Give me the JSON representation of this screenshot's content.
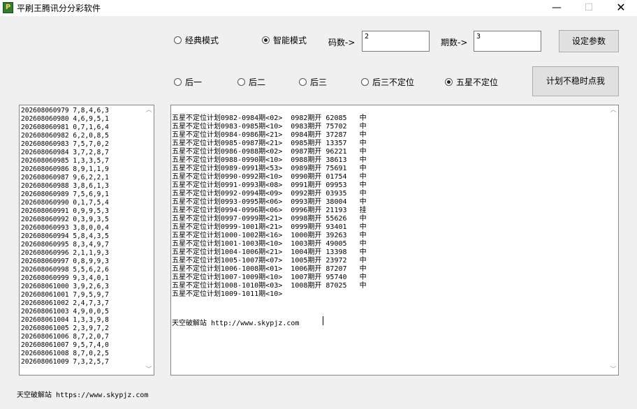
{
  "window": {
    "title": "平刷王腾讯分分彩软件",
    "app_icon": "app-logo-icon",
    "minimize_glyph": "—",
    "maximize_glyph": "☐",
    "close_glyph": "✕"
  },
  "modes": [
    {
      "label": "经典模式",
      "selected": false
    },
    {
      "label": "智能模式",
      "selected": true
    }
  ],
  "code_count": {
    "label": "码数->",
    "value": "2"
  },
  "period_count": {
    "label": "期数->",
    "value": "3"
  },
  "buttons": {
    "set_params": "设定参数",
    "unstable_plan": "计划不稳时点我"
  },
  "positions": [
    {
      "label": "后一",
      "selected": false
    },
    {
      "label": "后二",
      "selected": false
    },
    {
      "label": "后三",
      "selected": false
    },
    {
      "label": "后三不定位",
      "selected": false
    },
    {
      "label": "五星不定位",
      "selected": true
    }
  ],
  "history": [
    "202608060979 7,8,4,6,3",
    "202608060980 4,6,9,5,1",
    "202608060981 0,7,1,6,4",
    "202608060982 6,2,0,8,5",
    "202608060983 7,5,7,0,2",
    "202608060984 3,7,2,8,7",
    "202608060985 1,3,3,5,7",
    "202608060986 8,9,1,1,9",
    "202608060987 9,6,2,2,1",
    "202608060988 3,8,6,1,3",
    "202608060989 7,5,6,9,1",
    "202608060990 0,1,7,5,4",
    "202608060991 0,9,9,5,3",
    "202608060992 0,3,9,3,5",
    "202608060993 3,8,0,0,4",
    "202608060994 5,8,4,3,5",
    "202608060995 8,3,4,9,7",
    "202608060996 2,1,1,9,3",
    "202608060997 0,8,9,9,3",
    "202608060998 5,5,6,2,6",
    "202608060999 9,3,4,0,1",
    "202608061000 3,9,2,6,3",
    "202608061001 7,9,5,9,7",
    "202608061002 2,4,7,3,7",
    "202608061003 4,9,0,0,5",
    "202608061004 1,3,3,9,8",
    "202608061005 2,3,9,7,2",
    "202608061006 8,7,2,0,7",
    "202608061007 9,5,7,4,0",
    "202608061008 8,7,0,2,5",
    "202608061009 7,3,2,5,7"
  ],
  "plan_lines": [
    "五星不定位计划0982-0984期<02>  0982期开 62085   中",
    "五星不定位计划0983-0985期<10>  0983期开 75702   中",
    "五星不定位计划0984-0986期<21>  0984期开 37287   中",
    "五星不定位计划0985-0987期<21>  0985期开 13357   中",
    "五星不定位计划0986-0988期<02>  0987期开 96221   中",
    "五星不定位计划0988-0990期<10>  0988期开 38613   中",
    "五星不定位计划0989-0991期<53>  0989期开 75691   中",
    "五星不定位计划0990-0992期<10>  0990期开 01754   中",
    "五星不定位计划0991-0993期<08>  0991期开 09953   中",
    "五星不定位计划0992-0994期<09>  0992期开 03935   中",
    "五星不定位计划0993-0995期<06>  0993期开 38004   中",
    "五星不定位计划0994-0996期<06>  0996期开 21193   挂",
    "五星不定位计划0997-0999期<21>  0998期开 55626   中",
    "五星不定位计划0999-1001期<21>  0999期开 93401   中",
    "五星不定位计划1000-1002期<16>  1000期开 39263   中",
    "五星不定位计划1001-1003期<10>  1003期开 49005   中",
    "五星不定位计划1004-1006期<21>  1004期开 13398   中",
    "五星不定位计划1005-1007期<07>  1005期开 23972   中",
    "五星不定位计划1006-1008期<01>  1006期开 87207   中",
    "五星不定位计划1007-1009期<10>  1007期开 95740   中",
    "五星不定位计划1008-1010期<03>  1008期开 87025   中",
    "五星不定位计划1009-1011期<10>"
  ],
  "output_site_text": "天空破解站 http://www.skypjz.com",
  "footer_text": "天空破解站 https://www.skypjz.com"
}
